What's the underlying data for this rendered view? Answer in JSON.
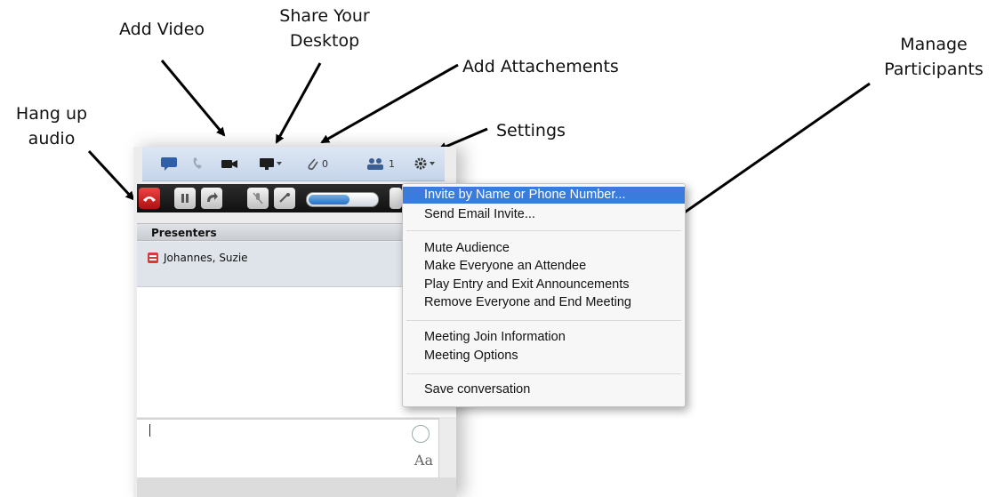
{
  "annotations": {
    "hang_up_audio": [
      "Hang up",
      "audio"
    ],
    "add_video": "Add Video",
    "share_desktop": [
      "Share Your",
      "Desktop"
    ],
    "add_attachments": "Add Attachements",
    "settings": "Settings",
    "manage_participants": [
      "Manage",
      "Participants"
    ]
  },
  "toolbar": {
    "attachment_count": "0",
    "participant_count": "1",
    "icons": [
      "im-icon",
      "phone-icon",
      "video-icon",
      "desktop-share-icon",
      "attachment-icon",
      "participants-icon",
      "gear-icon"
    ]
  },
  "audio_controls": {
    "icons": [
      "hang-up-icon",
      "hold-icon",
      "transfer-icon",
      "mute-mic-icon",
      "dialpad-icon"
    ],
    "volume_level": 0.6
  },
  "presenters": {
    "header": "Presenters",
    "members": [
      {
        "name": "Johannes, Suzie"
      }
    ]
  },
  "compose": {
    "font_button": "Aa"
  },
  "settings_menu": {
    "groups": [
      [
        "Invite by Name or Phone Number...",
        "Send Email Invite..."
      ],
      [
        "Mute Audience",
        "Make Everyone an Attendee",
        "Play Entry and Exit Announcements",
        "Remove Everyone and End Meeting"
      ],
      [
        "Meeting Join Information",
        "Meeting Options"
      ],
      [
        "Save conversation"
      ]
    ],
    "highlighted": "Invite by Name or Phone Number..."
  },
  "colors": {
    "menu_highlight": "#3a7bdc",
    "hangup_red": "#d41c1c",
    "toolbar_blue": "#c5d5ea"
  }
}
